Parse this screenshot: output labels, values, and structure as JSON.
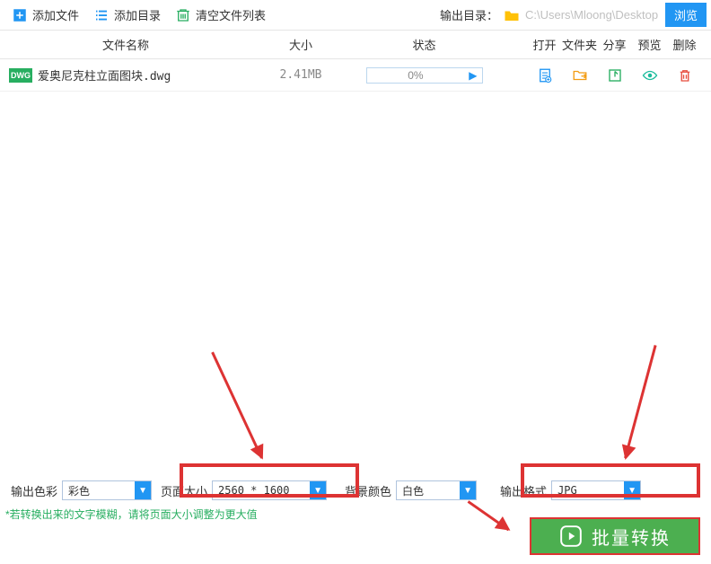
{
  "toolbar": {
    "add_file": "添加文件",
    "add_folder": "添加目录",
    "clear_list": "清空文件列表",
    "output_dir_label": "输出目录：",
    "output_dir_path": "C:\\Users\\Mloong\\Desktop",
    "browse": "浏览"
  },
  "headers": {
    "filename": "文件名称",
    "size": "大小",
    "status": "状态",
    "open": "打开",
    "folder": "文件夹",
    "share": "分享",
    "preview": "预览",
    "delete": "删除"
  },
  "files": [
    {
      "badge": "DWG",
      "name": "爱奥尼克柱立面图块.dwg",
      "size": "2.41MB",
      "progress": "0%"
    }
  ],
  "params": {
    "color_label": "输出色彩",
    "color_value": "彩色",
    "page_label": "页面大小",
    "page_value": "2560 * 1600",
    "bg_label": "背景颜色",
    "bg_value": "白色",
    "format_label": "输出格式",
    "format_value": "JPG"
  },
  "help_text": "*若转换出来的文字模糊，请将页面大小调整为更大值",
  "convert_btn": "批量转换"
}
